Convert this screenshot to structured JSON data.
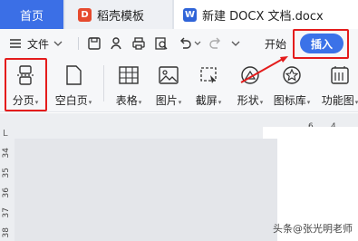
{
  "tabs": [
    {
      "label": "首页"
    },
    {
      "label": "稻壳模板",
      "icon": "D"
    },
    {
      "label": "新建 DOCX 文档.docx",
      "icon": "W"
    }
  ],
  "menu": {
    "file_label": "文件",
    "start_label": "开始",
    "insert_label": "插入"
  },
  "ribbon": {
    "items": [
      {
        "label": "分页"
      },
      {
        "label": "空白页"
      },
      {
        "label": "表格"
      },
      {
        "label": "图片"
      },
      {
        "label": "截屏"
      },
      {
        "label": "形状"
      },
      {
        "label": "图标库"
      },
      {
        "label": "功能图"
      }
    ]
  },
  "ruler": {
    "top_marks": [
      "6",
      "4"
    ],
    "left_marks": [
      "34",
      "35",
      "36",
      "37",
      "38"
    ],
    "corner": "L"
  },
  "watermark": "头条@张光明老师",
  "colors": {
    "accent": "#3b72e8",
    "annotation": "#e41c1c"
  }
}
